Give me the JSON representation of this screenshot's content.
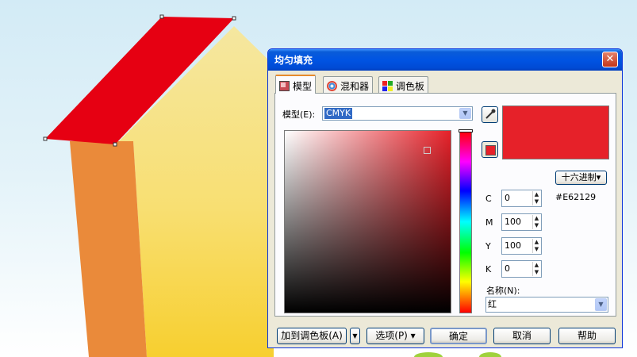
{
  "dialog": {
    "title": "均匀填充",
    "close_label": "✕",
    "tabs": [
      {
        "label": "模型",
        "icon": "model-icon"
      },
      {
        "label": "混和器",
        "icon": "mixer-icon"
      },
      {
        "label": "调色板",
        "icon": "palette-icon"
      }
    ],
    "active_tab": "模型",
    "model_label": "模型(E):",
    "model_value": "CMYK",
    "color_hex": "#E62129",
    "hex_mode_button": "十六进制▾",
    "hex_value": "#E62129",
    "cmyk": {
      "c_label": "C",
      "c_value": "0",
      "m_label": "M",
      "m_value": "100",
      "y_label": "Y",
      "y_value": "100",
      "k_label": "K",
      "k_value": "0"
    },
    "name_label": "名称(N):",
    "name_value": "红",
    "buttons": {
      "add_to_palette": "加到调色板(A)",
      "options": "选项(P) ▾",
      "ok": "确定",
      "cancel": "取消",
      "help": "帮助"
    }
  },
  "canvas": {
    "roof_color": "#e60012",
    "wall_orange": "#ea8a3a",
    "wall_yellow": "#f5e08a"
  }
}
